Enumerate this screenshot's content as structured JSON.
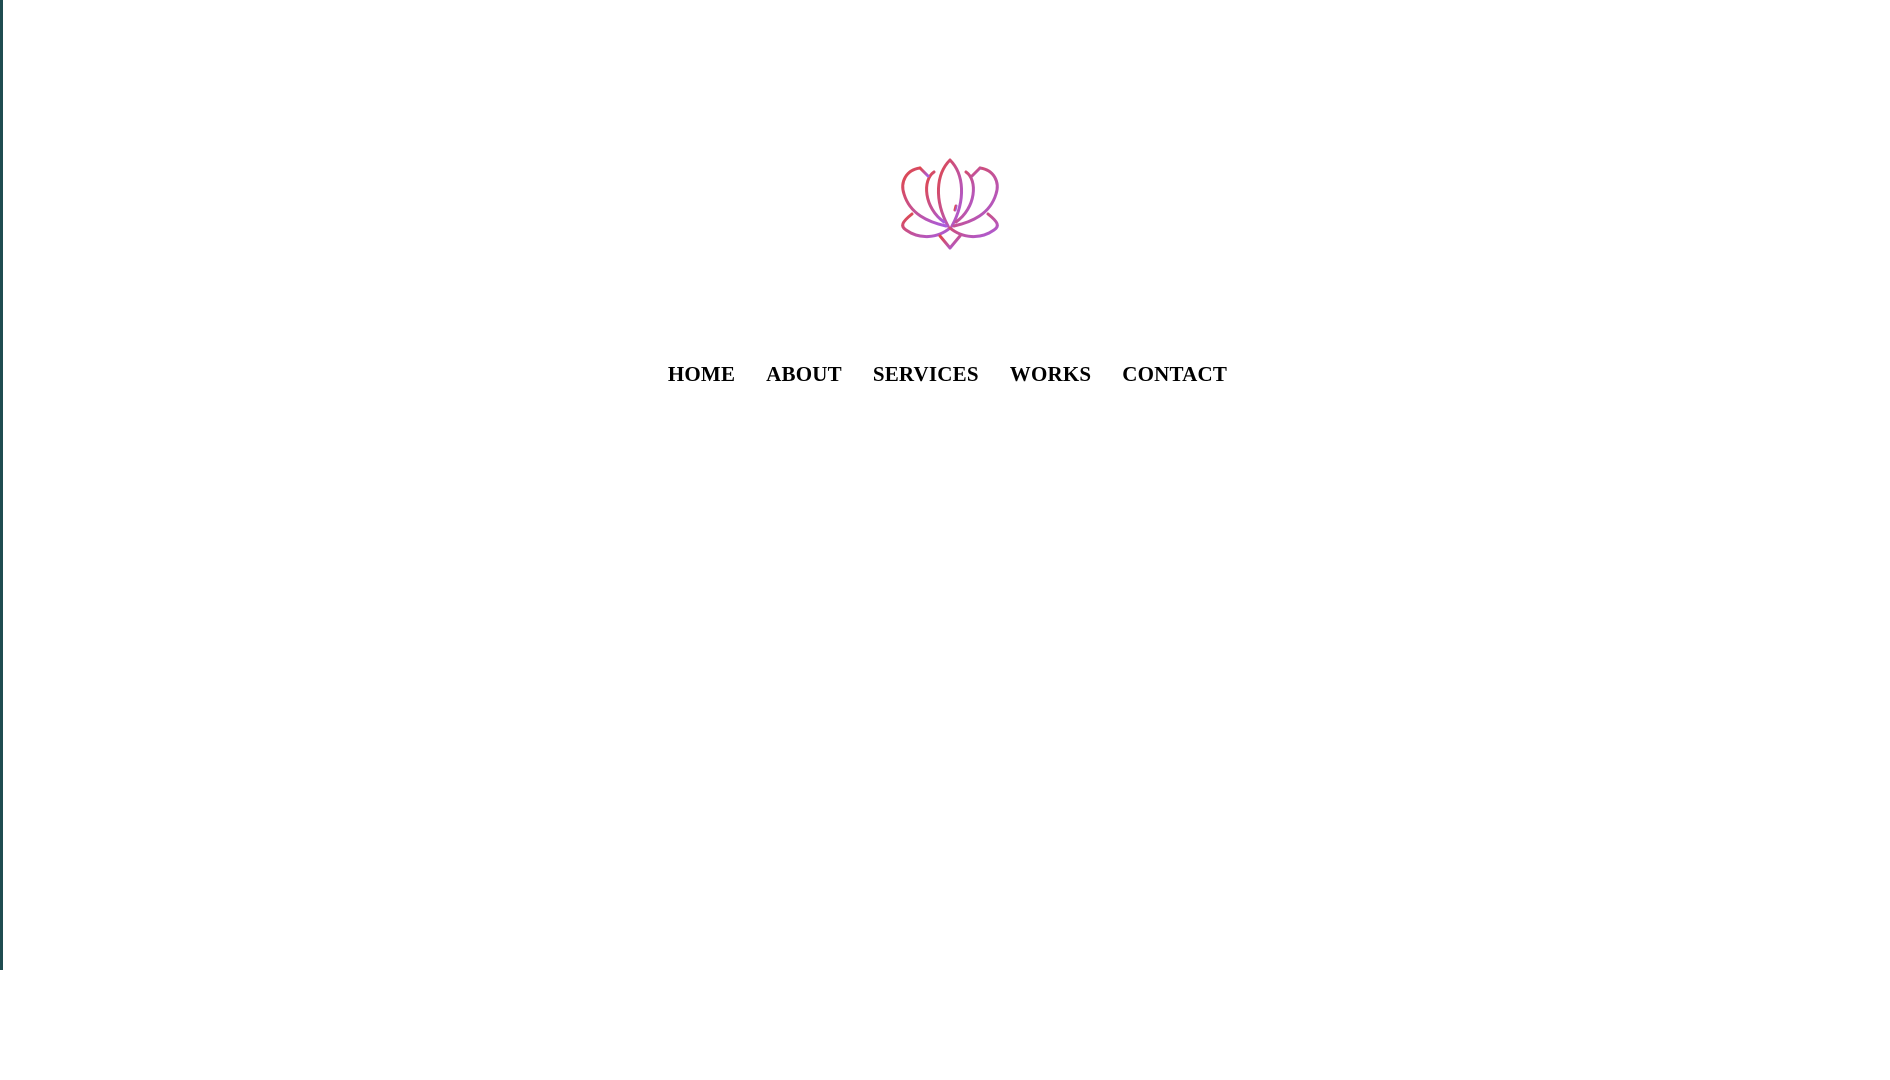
{
  "colors": {
    "left_edge": "#1f4c50",
    "nav_text": "#000000",
    "logo_gradient_start": "#e0474a",
    "logo_gradient_end": "#a85ce0"
  },
  "logo": {
    "icon": "lotus-icon"
  },
  "nav": {
    "items": [
      {
        "label": "HOME"
      },
      {
        "label": "ABOUT"
      },
      {
        "label": "SERVICES"
      },
      {
        "label": "WORKS"
      },
      {
        "label": "CONTACT"
      }
    ]
  }
}
